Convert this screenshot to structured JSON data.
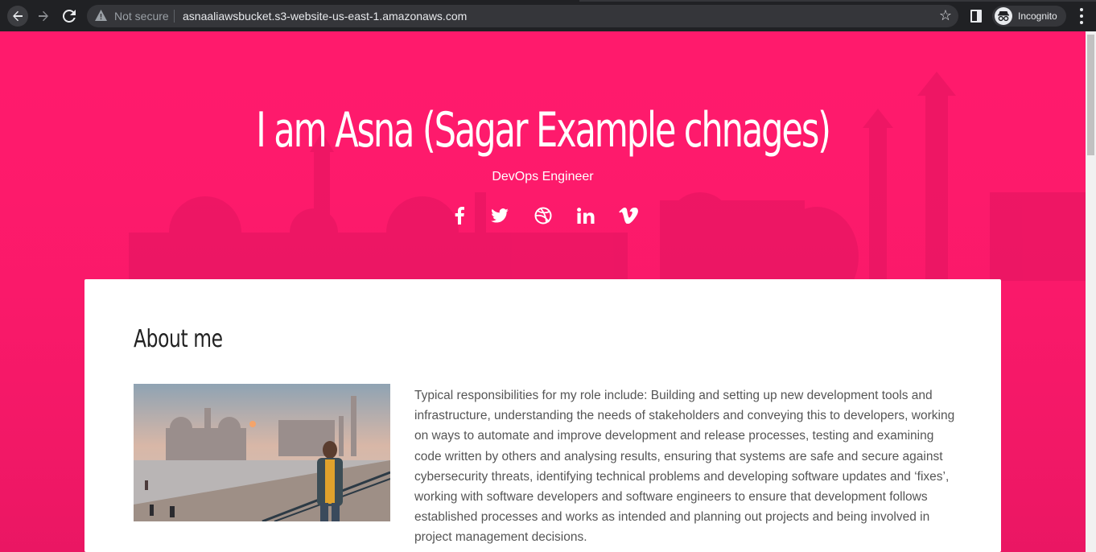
{
  "browser": {
    "security_label": "Not secure",
    "url": "asnaaliawsbucket.s3-website-us-east-1.amazonaws.com",
    "profile_label": "Incognito",
    "icons": [
      "back-arrow-icon",
      "forward-arrow-icon",
      "reload-icon",
      "warning-icon",
      "star-icon",
      "side-panel-icon",
      "incognito-icon",
      "kebab-menu-icon"
    ]
  },
  "hero": {
    "title": "I am Asna (Sagar Example chnages)",
    "subtitle": "DevOps Engineer",
    "socials": [
      {
        "name": "facebook",
        "icon": "facebook-icon"
      },
      {
        "name": "twitter",
        "icon": "twitter-icon"
      },
      {
        "name": "dribbble",
        "icon": "dribbble-icon"
      },
      {
        "name": "linkedin",
        "icon": "linkedin-icon"
      },
      {
        "name": "vimeo",
        "icon": "vimeo-icon"
      }
    ]
  },
  "about": {
    "heading": "About me",
    "text": "Typical responsibilities for my role include: Building and setting up new development tools and infrastructure, understanding the needs of stakeholders and conveying this to developers, working on ways to automate and improve development and release processes, testing and examining code written by others and analysing results, ensuring that systems are safe and secure against cybersecurity threats, identifying technical problems and developing software updates and ‘fixes’, working with software developers and software engineers to ensure that development follows established processes and works as intended and planning out projects and being involved in project management decisions."
  },
  "colors": {
    "accent": "#ff1a6c",
    "chrome": "#202124",
    "omnibox": "#35363a",
    "card": "#ffffff",
    "body_text": "#555555"
  }
}
